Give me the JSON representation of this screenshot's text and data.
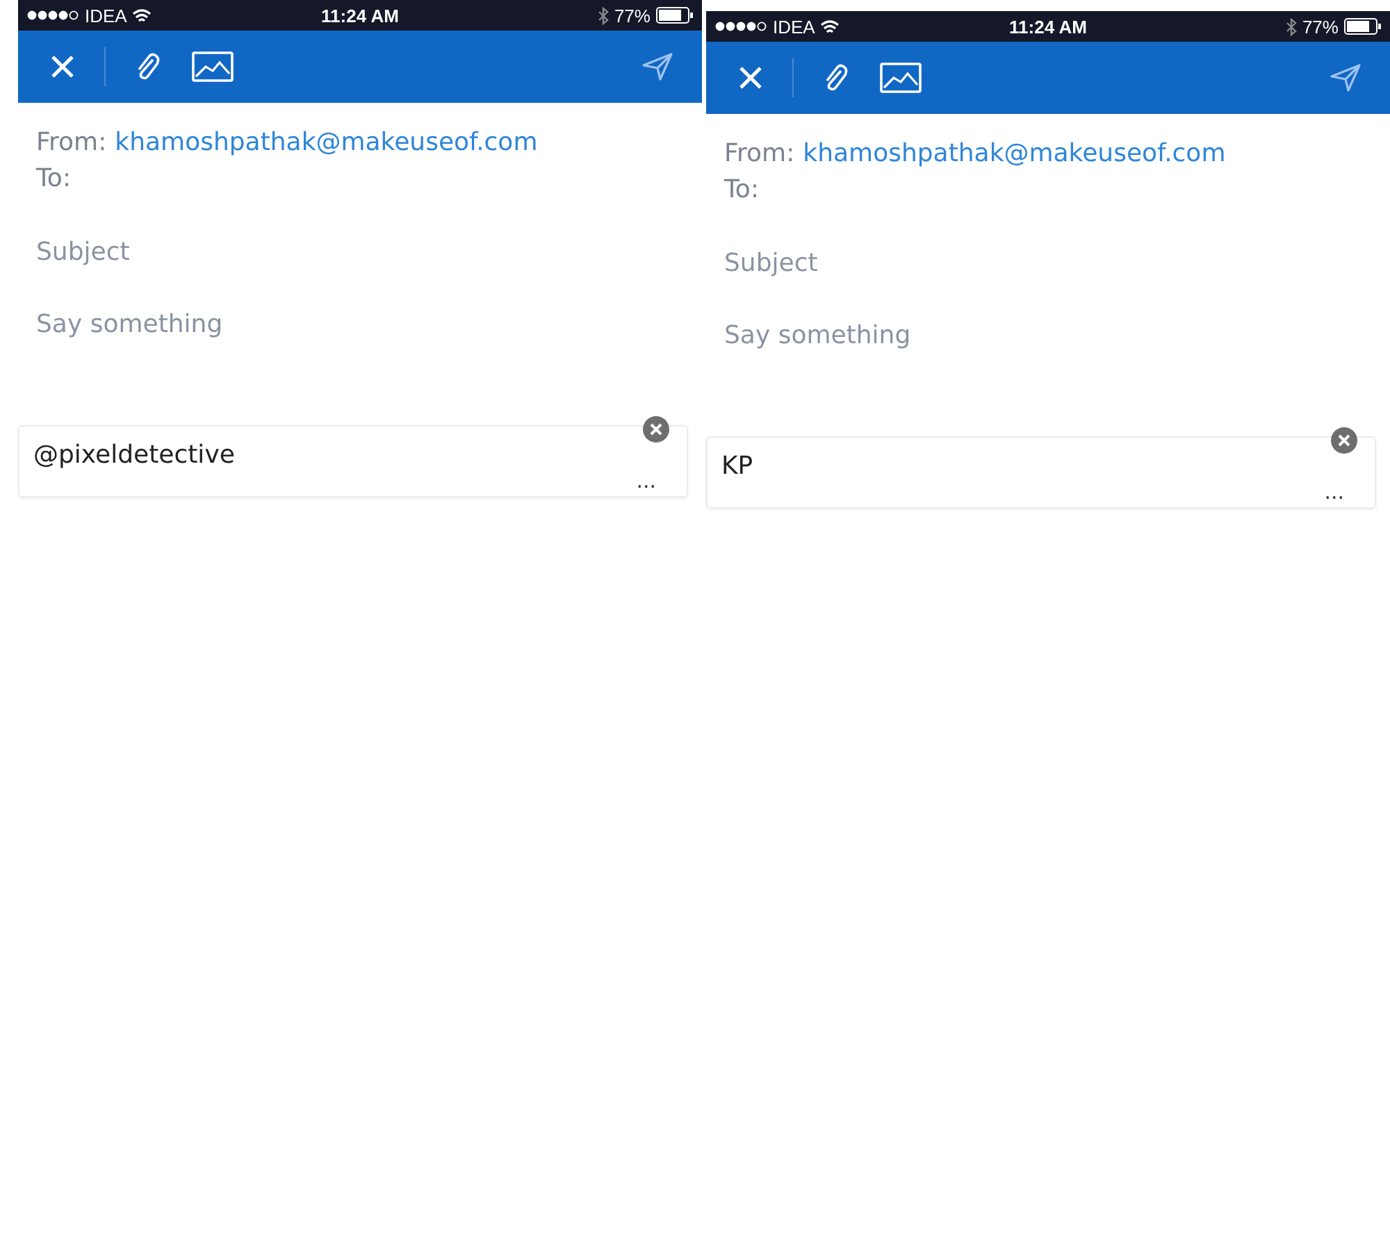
{
  "screens": [
    {
      "status_bar": {
        "carrier": "IDEA",
        "time": "11:24 AM",
        "battery": "77%"
      },
      "from": {
        "label": "From:",
        "address": "khamoshpathak@makeuseof.com"
      },
      "to": {
        "label": "To:"
      },
      "subject": {
        "placeholder": "Subject"
      },
      "body": {
        "placeholder": "Say something"
      },
      "signature": {
        "text": "@pixeldetective",
        "more": "..."
      }
    },
    {
      "status_bar": {
        "carrier": "IDEA",
        "time": "11:24 AM",
        "battery": "77%"
      },
      "from": {
        "label": "From:",
        "address": "khamoshpathak@makeuseof.com"
      },
      "to": {
        "label": "To:"
      },
      "subject": {
        "placeholder": "Subject"
      },
      "body": {
        "placeholder": "Say something"
      },
      "signature": {
        "text": "KP",
        "more": "..."
      }
    }
  ]
}
